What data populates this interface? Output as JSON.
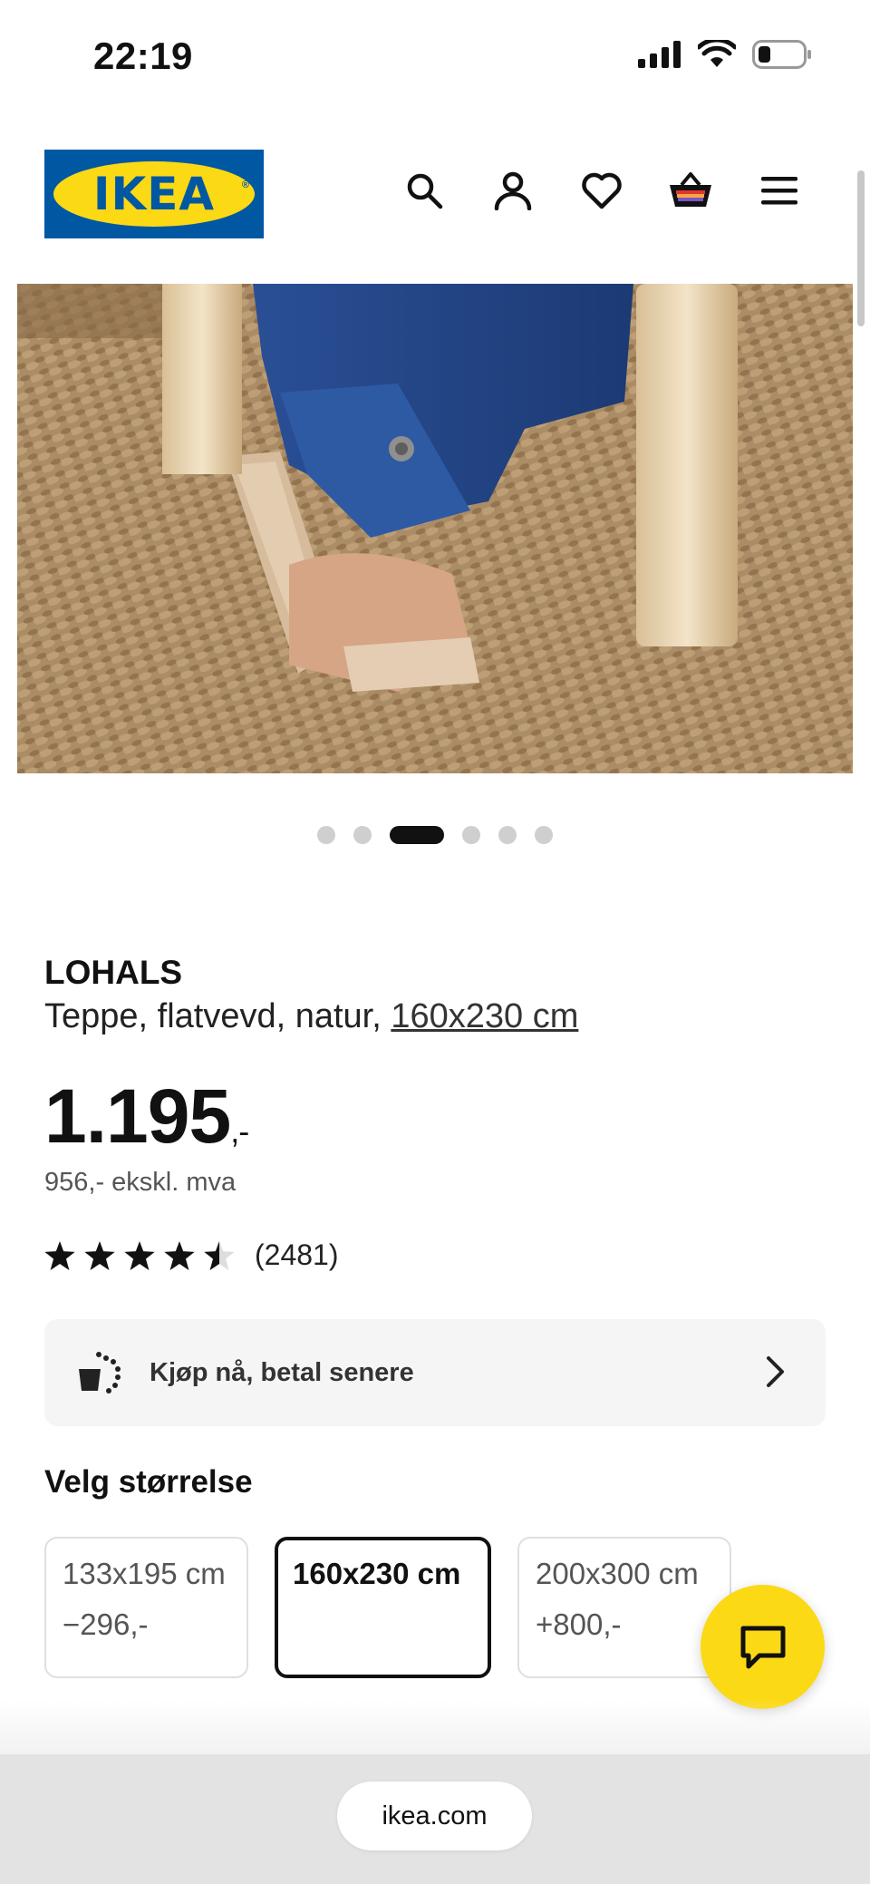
{
  "status_bar": {
    "time": "22:19"
  },
  "header": {
    "logo_text": "IKEA",
    "icons": [
      "search-icon",
      "account-icon",
      "heart-icon",
      "cart-icon",
      "menu-icon"
    ]
  },
  "carousel": {
    "total": 6,
    "active_index": 2
  },
  "product": {
    "name": "LOHALS",
    "description_prefix": "Teppe, flatvevd, natur, ",
    "size_link": "160x230 cm",
    "price_main": "1.195",
    "price_suffix": ",-",
    "price_ex_vat": "956,- ekskl. mva",
    "rating_stars": 4.5,
    "review_count": "(2481)"
  },
  "pay_later": {
    "label": "Kjøp nå, betal senere"
  },
  "size_section": {
    "title": "Velg størrelse",
    "options": [
      {
        "name": "133x195 cm",
        "price": "−296,-",
        "selected": false
      },
      {
        "name": "160x230 cm",
        "price": "",
        "selected": true
      },
      {
        "name": "200x300 cm",
        "price": "+800,-",
        "selected": false
      }
    ]
  },
  "browser": {
    "url": "ikea.com"
  },
  "colors": {
    "ikea_blue": "#0058a3",
    "ikea_yellow": "#fbd914"
  }
}
